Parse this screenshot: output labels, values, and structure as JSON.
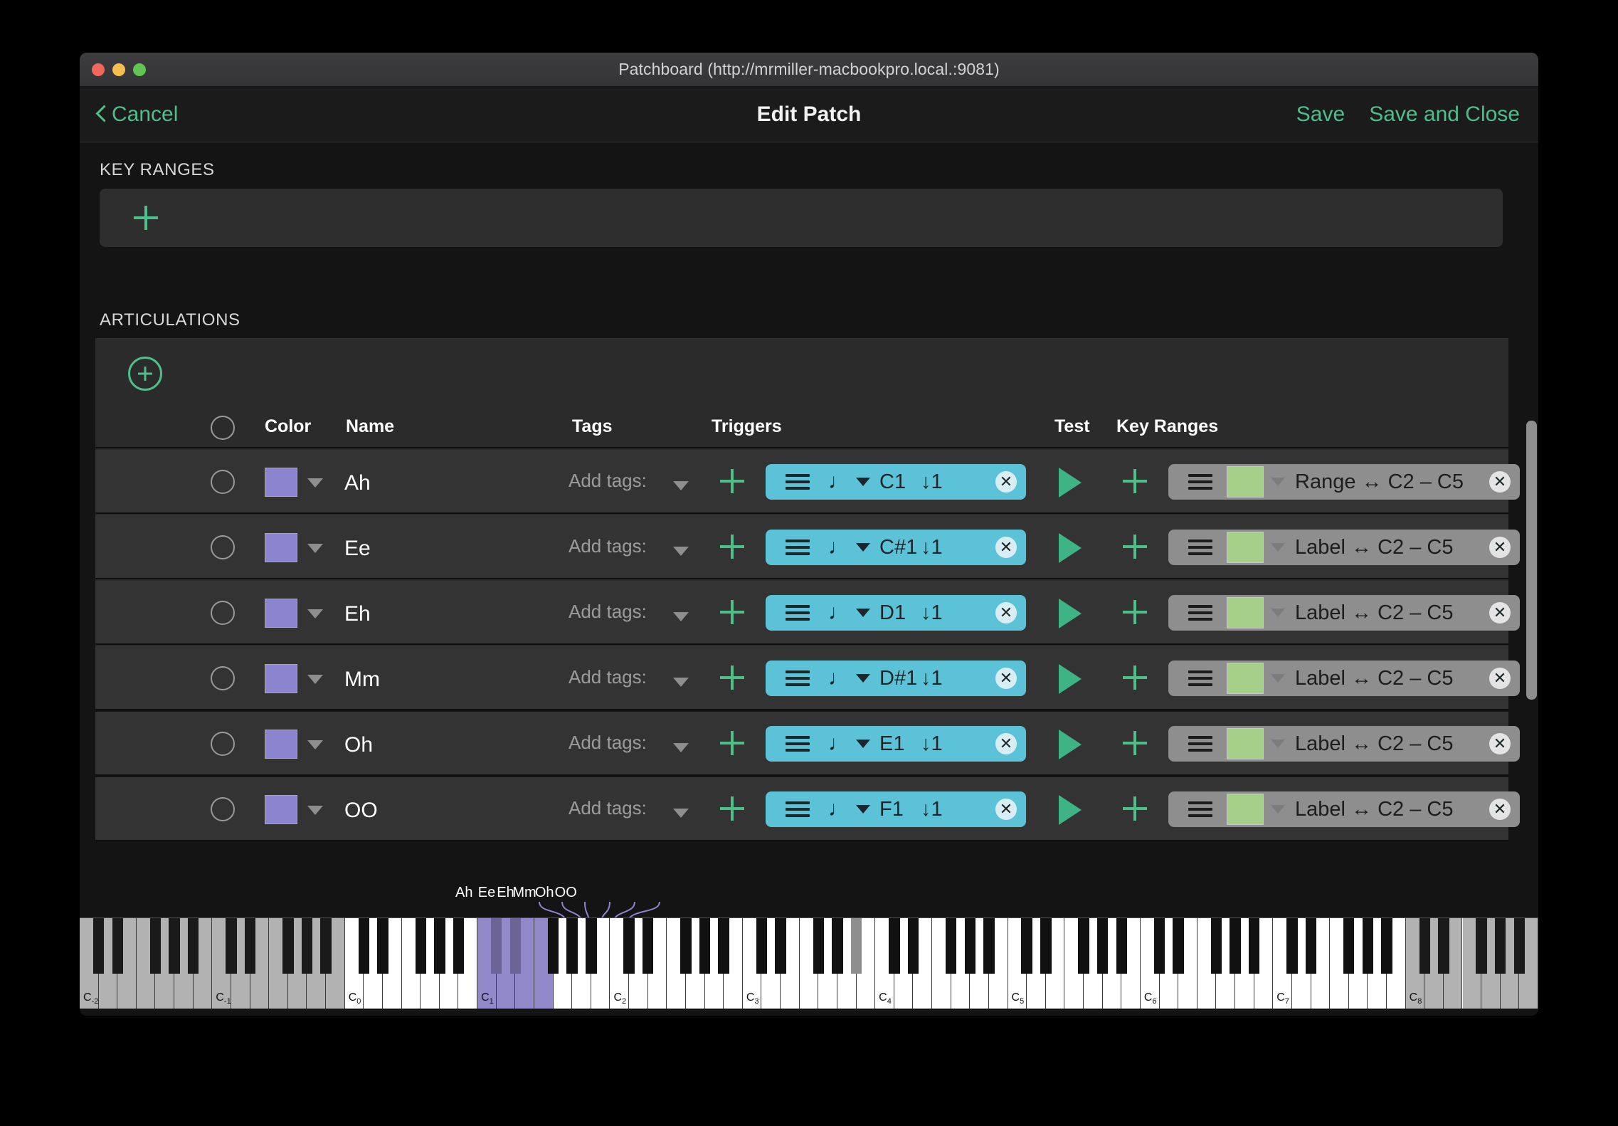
{
  "window": {
    "title": "Patchboard (http://mrmiller-macbookpro.local.:9081)",
    "traffic_lights": [
      "close-button",
      "minimize-button",
      "zoom-button"
    ]
  },
  "toolbar": {
    "cancel_label": "Cancel",
    "title": "Edit Patch",
    "save_label": "Save",
    "save_and_close_label": "Save and Close",
    "accent_color": "#4cbf8b"
  },
  "key_ranges_section": {
    "label": "KEY RANGES",
    "add_icon": "plus-icon"
  },
  "articulations_section": {
    "label": "ARTICULATIONS",
    "add_icon": "circle-plus-icon",
    "columns": {
      "select": "",
      "color": "Color",
      "name": "Name",
      "tags": "Tags",
      "triggers": "Triggers",
      "test": "Test",
      "key_ranges": "Key Ranges",
      "move": "move-icon"
    },
    "rows": [
      {
        "name": "Ah",
        "color": "#8b84cf",
        "tags_placeholder": "Add tags:",
        "trigger": {
          "note": "C1",
          "velocity": "1",
          "glyph": "♩",
          "color": "#5cc2d8"
        },
        "key_range": {
          "text": "Range ↔ C2 – C5",
          "color": "#a6cf8a"
        }
      },
      {
        "name": "Ee",
        "color": "#8b84cf",
        "tags_placeholder": "Add tags:",
        "trigger": {
          "note": "C#1",
          "velocity": "1",
          "glyph": "♩",
          "color": "#5cc2d8"
        },
        "key_range": {
          "text": "Label ↔ C2 – C5",
          "color": "#a6cf8a"
        }
      },
      {
        "name": "Eh",
        "color": "#8b84cf",
        "tags_placeholder": "Add tags:",
        "trigger": {
          "note": "D1",
          "velocity": "1",
          "glyph": "♩",
          "color": "#5cc2d8"
        },
        "key_range": {
          "text": "Label ↔ C2 – C5",
          "color": "#a6cf8a"
        }
      },
      {
        "name": "Mm",
        "color": "#8b84cf",
        "tags_placeholder": "Add tags:",
        "trigger": {
          "note": "D#1",
          "velocity": "1",
          "glyph": "♩",
          "color": "#5cc2d8"
        },
        "key_range": {
          "text": "Label ↔ C2 – C5",
          "color": "#a6cf8a"
        }
      },
      {
        "name": "Oh",
        "color": "#8b84cf",
        "tags_placeholder": "Add tags:",
        "trigger": {
          "note": "E1",
          "velocity": "1",
          "glyph": "♩",
          "color": "#5cc2d8"
        },
        "key_range": {
          "text": "Label ↔ C2 – C5",
          "color": "#a6cf8a"
        }
      },
      {
        "name": "OO",
        "color": "#8b84cf",
        "tags_placeholder": "Add tags:",
        "trigger": {
          "note": "F1",
          "velocity": "1",
          "glyph": "♩",
          "color": "#5cc2d8"
        },
        "key_range": {
          "text": "Label ↔ C2 – C5",
          "color": "#a6cf8a"
        }
      }
    ]
  },
  "keyboard": {
    "articulation_labels": [
      "Ah",
      "Ee",
      "Eh",
      "Mm",
      "Oh",
      "OO"
    ],
    "octave_labels": [
      "C-2",
      "C-1",
      "C0",
      "C1",
      "C2",
      "C3",
      "C4",
      "C5",
      "C6",
      "C7",
      "C8"
    ],
    "selected_range": "C1 - F1",
    "selected_color": "#9289ca",
    "out_of_range_color": "#b2b2b2"
  }
}
